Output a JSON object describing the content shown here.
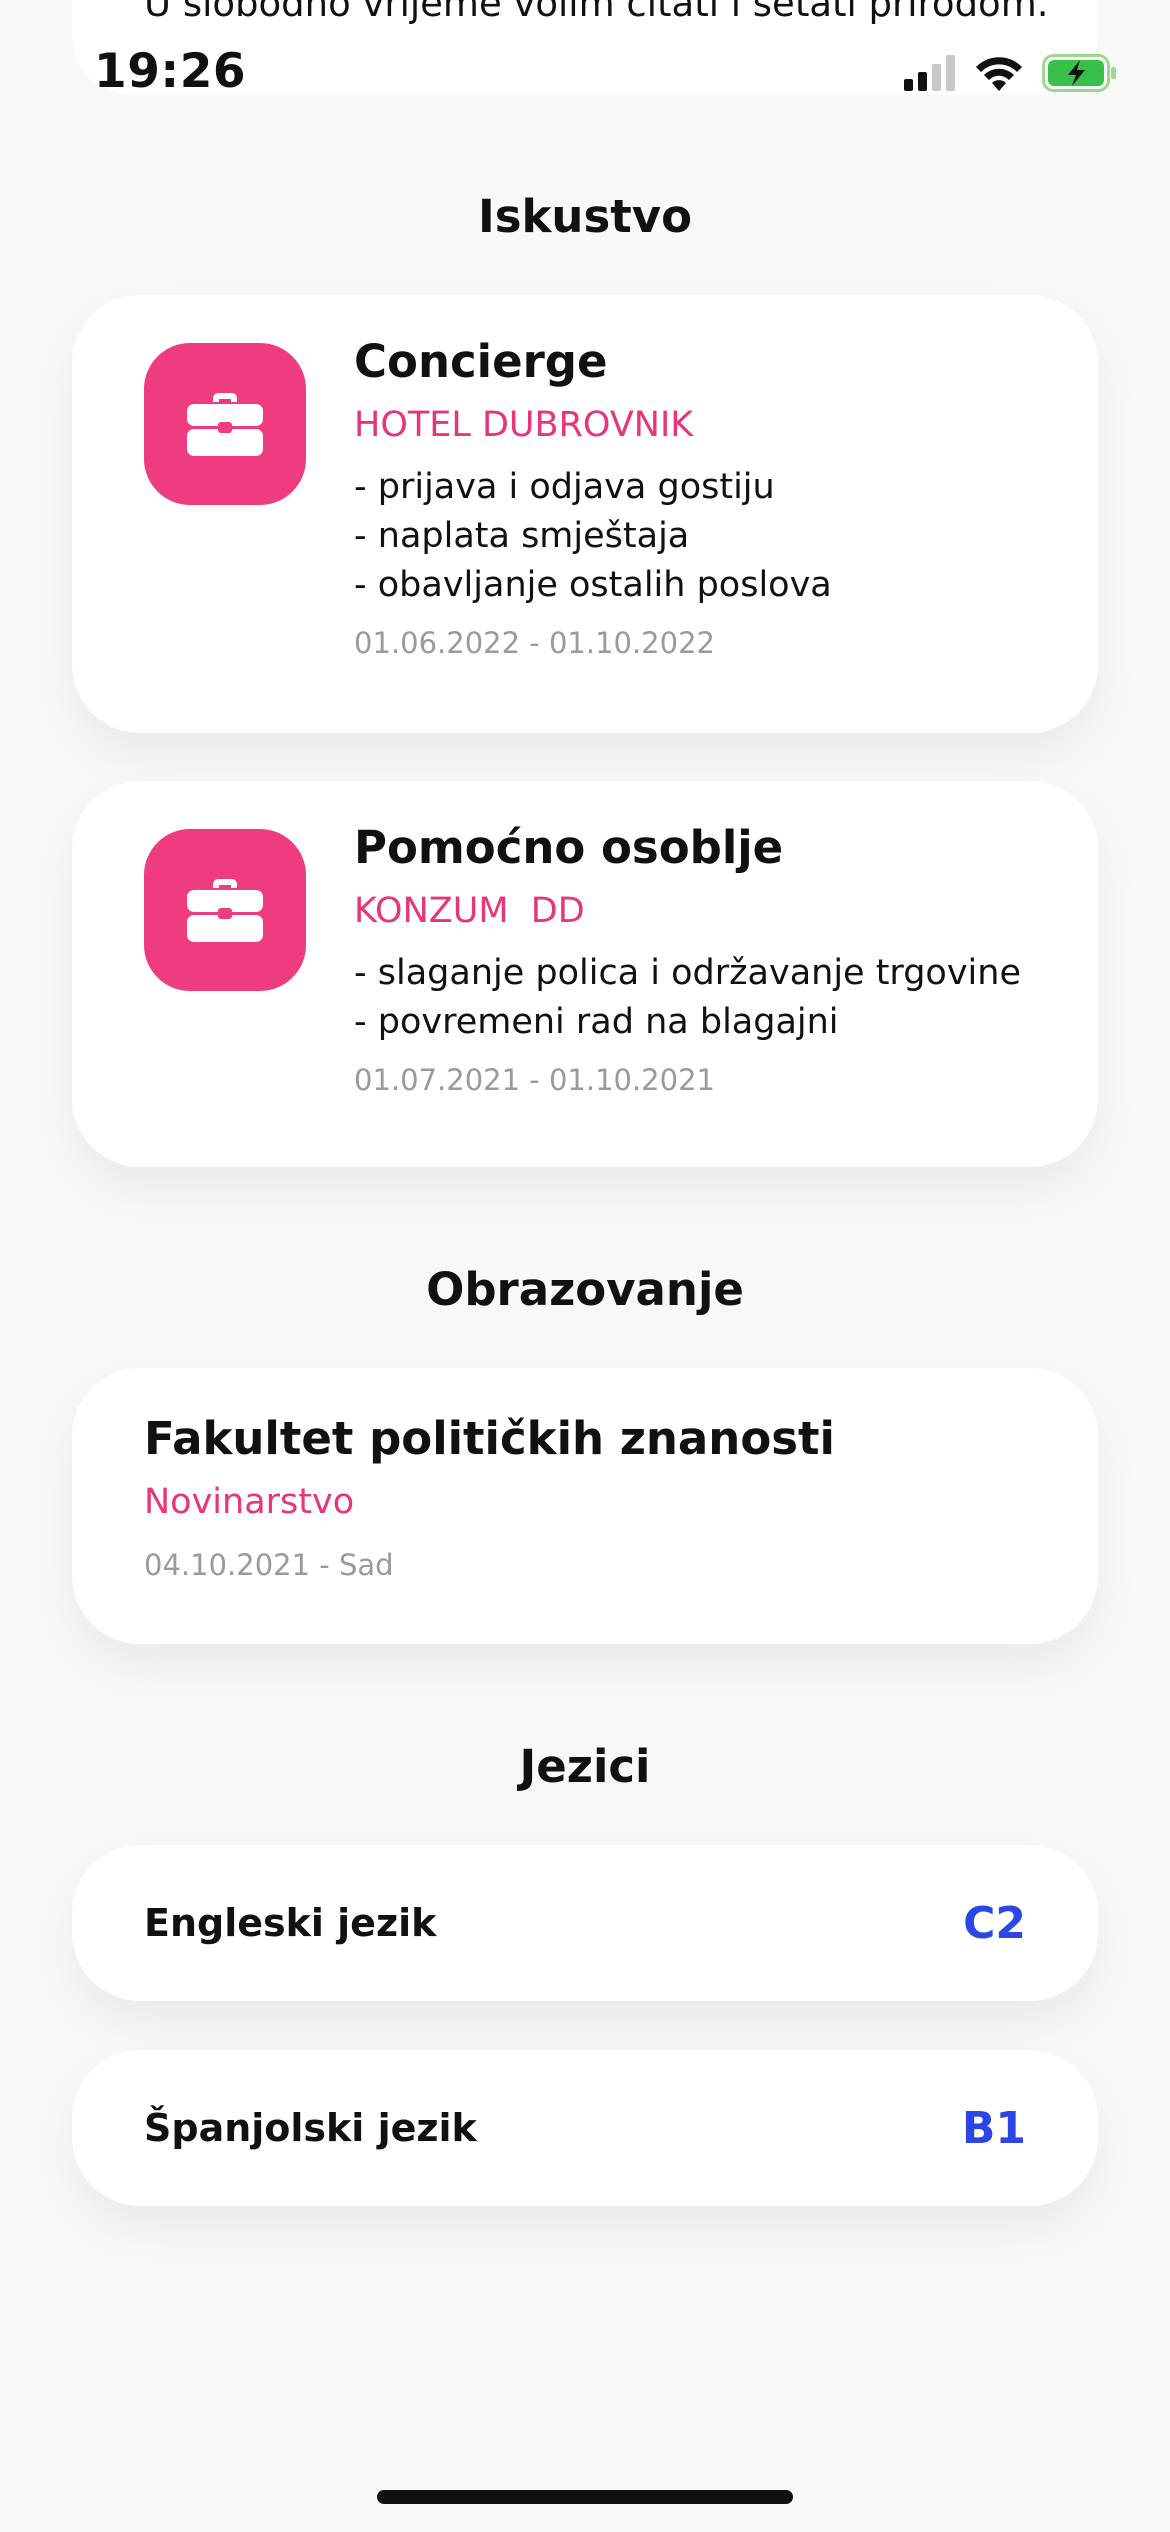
{
  "peek": {
    "text": "U slobodno vrijeme volim čitati i šetati prirodom."
  },
  "status_bar": {
    "time": "19:26",
    "icons": [
      "signal-icon",
      "wifi-icon",
      "battery-charging-icon"
    ]
  },
  "sections": {
    "experience_title": "Iskustvo",
    "education_title": "Obrazovanje",
    "languages_title": "Jezici"
  },
  "experience": [
    {
      "title": "Concierge",
      "company": "HOTEL DUBROVNIK",
      "duties": [
        "- prijava i odjava gostiju",
        "- naplata smještaja",
        "- obavljanje ostalih poslova"
      ],
      "dates": "01.06.2022 - 01.10.2022",
      "icon": "briefcase-icon"
    },
    {
      "title": "Pomoćno osoblje",
      "company": "KONZUM  DD",
      "duties": [
        "- slaganje polica i održavanje trgovine",
        "- povremeni rad na blagajni"
      ],
      "dates": "01.07.2021 - 01.10.2021",
      "icon": "briefcase-icon"
    }
  ],
  "education": [
    {
      "institution": "Fakultet političkih znanosti",
      "field": "Novinarstvo",
      "dates": "04.10.2021 - Sad"
    }
  ],
  "languages": [
    {
      "name": "Engleski jezik",
      "level": "C2"
    },
    {
      "name": "Španjolski jezik",
      "level": "B1"
    }
  ],
  "colors": {
    "accent_pink": "#ef3b7f",
    "level_blue": "#2a47e6",
    "muted": "#9a9a9a"
  }
}
